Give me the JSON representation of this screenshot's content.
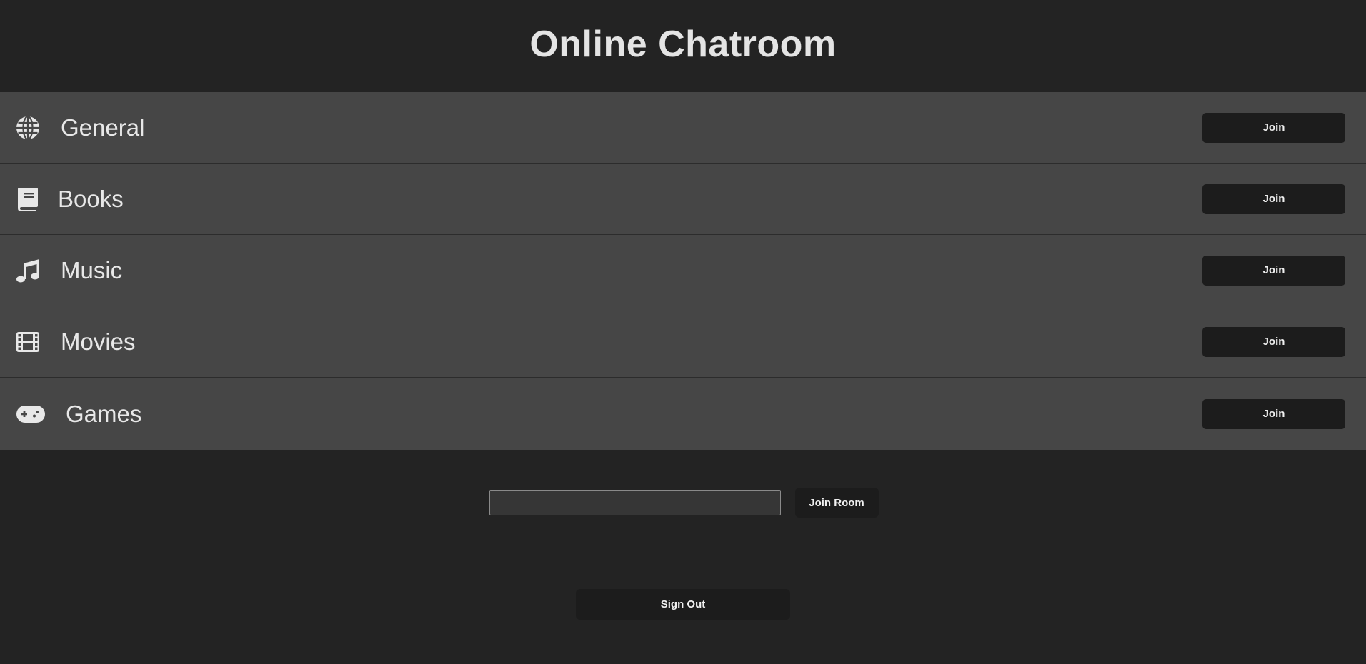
{
  "header": {
    "title": "Online Chatroom"
  },
  "rooms": [
    {
      "label": "General",
      "icon": "globe-icon",
      "join_label": "Join"
    },
    {
      "label": "Books",
      "icon": "book-icon",
      "join_label": "Join"
    },
    {
      "label": "Music",
      "icon": "music-note-icon",
      "join_label": "Join"
    },
    {
      "label": "Movies",
      "icon": "film-icon",
      "join_label": "Join"
    },
    {
      "label": "Games",
      "icon": "gamepad-icon",
      "join_label": "Join"
    }
  ],
  "join_room": {
    "input_value": "",
    "input_placeholder": "",
    "button_label": "Join Room"
  },
  "sign_out": {
    "label": "Sign Out"
  },
  "colors": {
    "background": "#232323",
    "room_row": "#464646",
    "button": "#1c1c1c",
    "text": "#e6e6e6"
  }
}
